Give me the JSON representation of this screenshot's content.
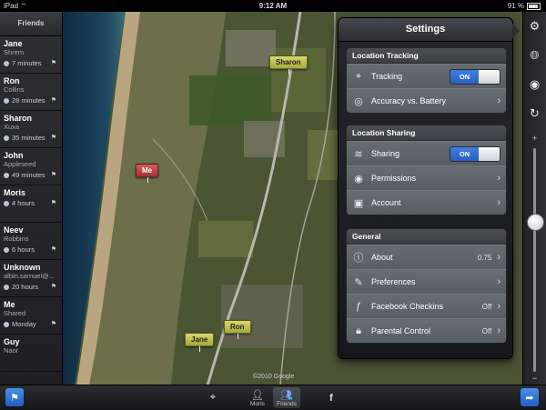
{
  "status_bar": {
    "device": "iPad",
    "time": "9:12 AM",
    "battery": "91 %"
  },
  "sidebar": {
    "title": "Friends",
    "friends": [
      {
        "name": "Jane",
        "sub": "Shrem",
        "time": "7 minutes"
      },
      {
        "name": "Ron",
        "sub": "Collins",
        "time": "28 minutes"
      },
      {
        "name": "Sharon",
        "sub": "Xuxa",
        "time": "35 minutes"
      },
      {
        "name": "John",
        "sub": "Appleseed",
        "time": "49 minutes"
      },
      {
        "name": "Moris",
        "sub": "",
        "time": "4 hours"
      },
      {
        "name": "Neev",
        "sub": "Robbins",
        "time": "6 hours"
      },
      {
        "name": "Unknown",
        "sub": "albin.samuel@...",
        "time": "20 hours"
      },
      {
        "name": "Me",
        "sub": "Shared",
        "time": "Monday"
      },
      {
        "name": "Guy",
        "sub": "Naor",
        "time": ""
      }
    ]
  },
  "map": {
    "pins": [
      {
        "label": "Sharon",
        "color": "yellow"
      },
      {
        "label": "Me",
        "color": "red"
      },
      {
        "label": "Jane",
        "color": "yellow"
      },
      {
        "label": "Ron",
        "color": "yellow"
      }
    ],
    "copyright": "©2010 Google"
  },
  "settings": {
    "title": "Settings",
    "groups": [
      {
        "header": "Location Tracking",
        "rows": [
          {
            "label": "Tracking",
            "toggle": "ON"
          },
          {
            "label": "Accuracy vs. Battery"
          }
        ]
      },
      {
        "header": "Location Sharing",
        "rows": [
          {
            "label": "Sharing",
            "toggle": "ON"
          },
          {
            "label": "Permissions"
          },
          {
            "label": "Account"
          }
        ]
      },
      {
        "header": "General",
        "rows": [
          {
            "label": "About",
            "value": "0.75"
          },
          {
            "label": "Preferences"
          },
          {
            "label": "Facebook Checkins",
            "value": "Off"
          },
          {
            "label": "Parental Control",
            "value": "Off"
          }
        ]
      }
    ]
  },
  "right_toolbar": {
    "zoom_level": 0.33
  },
  "bottom_bar": {
    "tab_moris": "Moris",
    "tab_friends": "Friends"
  },
  "colors": {
    "accent_blue": "#2a5fc0",
    "pin_yellow": "#c9c95a",
    "pin_red": "#c04040"
  }
}
